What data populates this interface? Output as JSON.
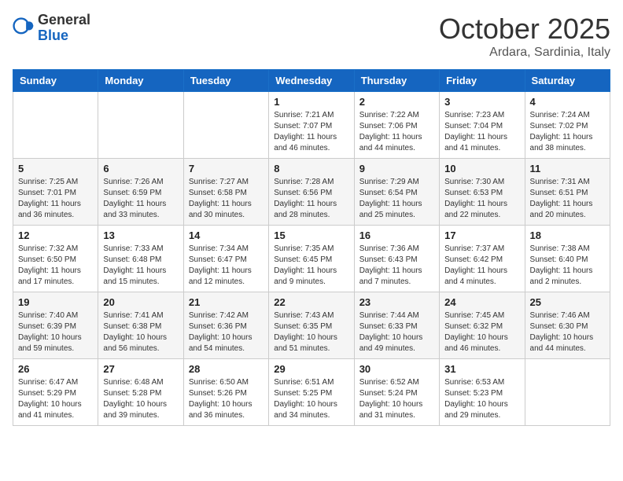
{
  "header": {
    "logo_general": "General",
    "logo_blue": "Blue",
    "month": "October 2025",
    "location": "Ardara, Sardinia, Italy"
  },
  "weekdays": [
    "Sunday",
    "Monday",
    "Tuesday",
    "Wednesday",
    "Thursday",
    "Friday",
    "Saturday"
  ],
  "weeks": [
    [
      {
        "day": "",
        "info": ""
      },
      {
        "day": "",
        "info": ""
      },
      {
        "day": "",
        "info": ""
      },
      {
        "day": "1",
        "info": "Sunrise: 7:21 AM\nSunset: 7:07 PM\nDaylight: 11 hours and 46 minutes."
      },
      {
        "day": "2",
        "info": "Sunrise: 7:22 AM\nSunset: 7:06 PM\nDaylight: 11 hours and 44 minutes."
      },
      {
        "day": "3",
        "info": "Sunrise: 7:23 AM\nSunset: 7:04 PM\nDaylight: 11 hours and 41 minutes."
      },
      {
        "day": "4",
        "info": "Sunrise: 7:24 AM\nSunset: 7:02 PM\nDaylight: 11 hours and 38 minutes."
      }
    ],
    [
      {
        "day": "5",
        "info": "Sunrise: 7:25 AM\nSunset: 7:01 PM\nDaylight: 11 hours and 36 minutes."
      },
      {
        "day": "6",
        "info": "Sunrise: 7:26 AM\nSunset: 6:59 PM\nDaylight: 11 hours and 33 minutes."
      },
      {
        "day": "7",
        "info": "Sunrise: 7:27 AM\nSunset: 6:58 PM\nDaylight: 11 hours and 30 minutes."
      },
      {
        "day": "8",
        "info": "Sunrise: 7:28 AM\nSunset: 6:56 PM\nDaylight: 11 hours and 28 minutes."
      },
      {
        "day": "9",
        "info": "Sunrise: 7:29 AM\nSunset: 6:54 PM\nDaylight: 11 hours and 25 minutes."
      },
      {
        "day": "10",
        "info": "Sunrise: 7:30 AM\nSunset: 6:53 PM\nDaylight: 11 hours and 22 minutes."
      },
      {
        "day": "11",
        "info": "Sunrise: 7:31 AM\nSunset: 6:51 PM\nDaylight: 11 hours and 20 minutes."
      }
    ],
    [
      {
        "day": "12",
        "info": "Sunrise: 7:32 AM\nSunset: 6:50 PM\nDaylight: 11 hours and 17 minutes."
      },
      {
        "day": "13",
        "info": "Sunrise: 7:33 AM\nSunset: 6:48 PM\nDaylight: 11 hours and 15 minutes."
      },
      {
        "day": "14",
        "info": "Sunrise: 7:34 AM\nSunset: 6:47 PM\nDaylight: 11 hours and 12 minutes."
      },
      {
        "day": "15",
        "info": "Sunrise: 7:35 AM\nSunset: 6:45 PM\nDaylight: 11 hours and 9 minutes."
      },
      {
        "day": "16",
        "info": "Sunrise: 7:36 AM\nSunset: 6:43 PM\nDaylight: 11 hours and 7 minutes."
      },
      {
        "day": "17",
        "info": "Sunrise: 7:37 AM\nSunset: 6:42 PM\nDaylight: 11 hours and 4 minutes."
      },
      {
        "day": "18",
        "info": "Sunrise: 7:38 AM\nSunset: 6:40 PM\nDaylight: 11 hours and 2 minutes."
      }
    ],
    [
      {
        "day": "19",
        "info": "Sunrise: 7:40 AM\nSunset: 6:39 PM\nDaylight: 10 hours and 59 minutes."
      },
      {
        "day": "20",
        "info": "Sunrise: 7:41 AM\nSunset: 6:38 PM\nDaylight: 10 hours and 56 minutes."
      },
      {
        "day": "21",
        "info": "Sunrise: 7:42 AM\nSunset: 6:36 PM\nDaylight: 10 hours and 54 minutes."
      },
      {
        "day": "22",
        "info": "Sunrise: 7:43 AM\nSunset: 6:35 PM\nDaylight: 10 hours and 51 minutes."
      },
      {
        "day": "23",
        "info": "Sunrise: 7:44 AM\nSunset: 6:33 PM\nDaylight: 10 hours and 49 minutes."
      },
      {
        "day": "24",
        "info": "Sunrise: 7:45 AM\nSunset: 6:32 PM\nDaylight: 10 hours and 46 minutes."
      },
      {
        "day": "25",
        "info": "Sunrise: 7:46 AM\nSunset: 6:30 PM\nDaylight: 10 hours and 44 minutes."
      }
    ],
    [
      {
        "day": "26",
        "info": "Sunrise: 6:47 AM\nSunset: 5:29 PM\nDaylight: 10 hours and 41 minutes."
      },
      {
        "day": "27",
        "info": "Sunrise: 6:48 AM\nSunset: 5:28 PM\nDaylight: 10 hours and 39 minutes."
      },
      {
        "day": "28",
        "info": "Sunrise: 6:50 AM\nSunset: 5:26 PM\nDaylight: 10 hours and 36 minutes."
      },
      {
        "day": "29",
        "info": "Sunrise: 6:51 AM\nSunset: 5:25 PM\nDaylight: 10 hours and 34 minutes."
      },
      {
        "day": "30",
        "info": "Sunrise: 6:52 AM\nSunset: 5:24 PM\nDaylight: 10 hours and 31 minutes."
      },
      {
        "day": "31",
        "info": "Sunrise: 6:53 AM\nSunset: 5:23 PM\nDaylight: 10 hours and 29 minutes."
      },
      {
        "day": "",
        "info": ""
      }
    ]
  ]
}
